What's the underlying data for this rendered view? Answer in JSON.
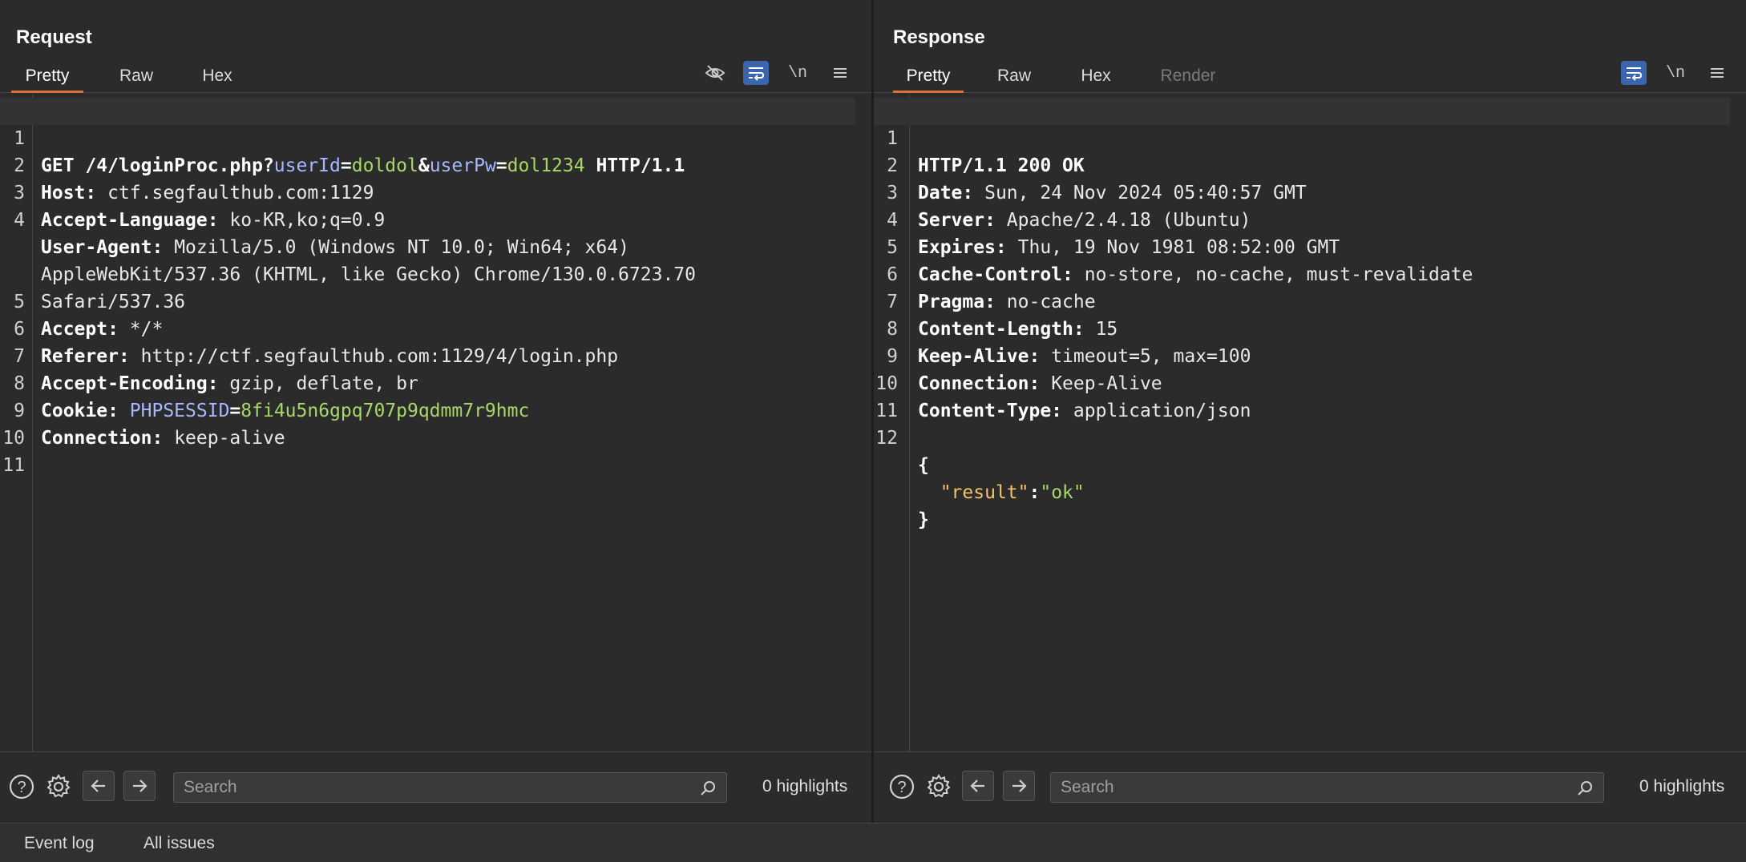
{
  "request": {
    "title": "Request",
    "tabs": [
      "Pretty",
      "Raw",
      "Hex"
    ],
    "active_tab": "Pretty",
    "lines": [
      "GET /4/loginProc.php?userId=doldol&userPw=dol1234 HTTP/1.1",
      "Host: ctf.segfaulthub.com:1129",
      "Accept-Language: ko-KR,ko;q=0.9",
      "User-Agent: Mozilla/5.0 (Windows NT 10.0; Win64; x64)",
      "AppleWebKit/537.36 (KHTML, like Gecko) Chrome/130.0.6723.70",
      "Safari/537.36",
      "Accept: */*",
      "Referer: http://ctf.segfaulthub.com:1129/4/login.php",
      "Accept-Encoding: gzip, deflate, br",
      "Cookie: PHPSESSID=8fi4u5n6gpq707p9qdmm7r9hmc",
      "Connection: keep-alive"
    ],
    "line_numbers": [
      "1",
      "2",
      "3",
      "4",
      "",
      "",
      "5",
      "6",
      "7",
      "8",
      "9",
      "10",
      "11"
    ],
    "search_placeholder": "Search",
    "highlights": "0 highlights"
  },
  "response": {
    "title": "Response",
    "tabs": [
      "Pretty",
      "Raw",
      "Hex",
      "Render"
    ],
    "active_tab": "Pretty",
    "line_numbers": [
      "1",
      "2",
      "3",
      "4",
      "5",
      "6",
      "7",
      "8",
      "9",
      "10",
      "11",
      "12",
      "",
      ""
    ],
    "lines": [
      "HTTP/1.1 200 OK",
      "Date: Sun, 24 Nov 2024 05:40:57 GMT",
      "Server: Apache/2.4.18 (Ubuntu)",
      "Expires: Thu, 19 Nov 1981 08:52:00 GMT",
      "Cache-Control: no-store, no-cache, must-revalidate",
      "Pragma: no-cache",
      "Content-Length: 15",
      "Keep-Alive: timeout=5, max=100",
      "Connection: Keep-Alive",
      "Content-Type: application/json",
      "{",
      "\"result\":\"ok\"",
      "}"
    ],
    "search_placeholder": "Search",
    "highlights": "0 highlights"
  },
  "toolbar": {
    "newline_label": "\\n"
  },
  "status": {
    "event_log": "Event log",
    "all_issues": "All issues"
  }
}
